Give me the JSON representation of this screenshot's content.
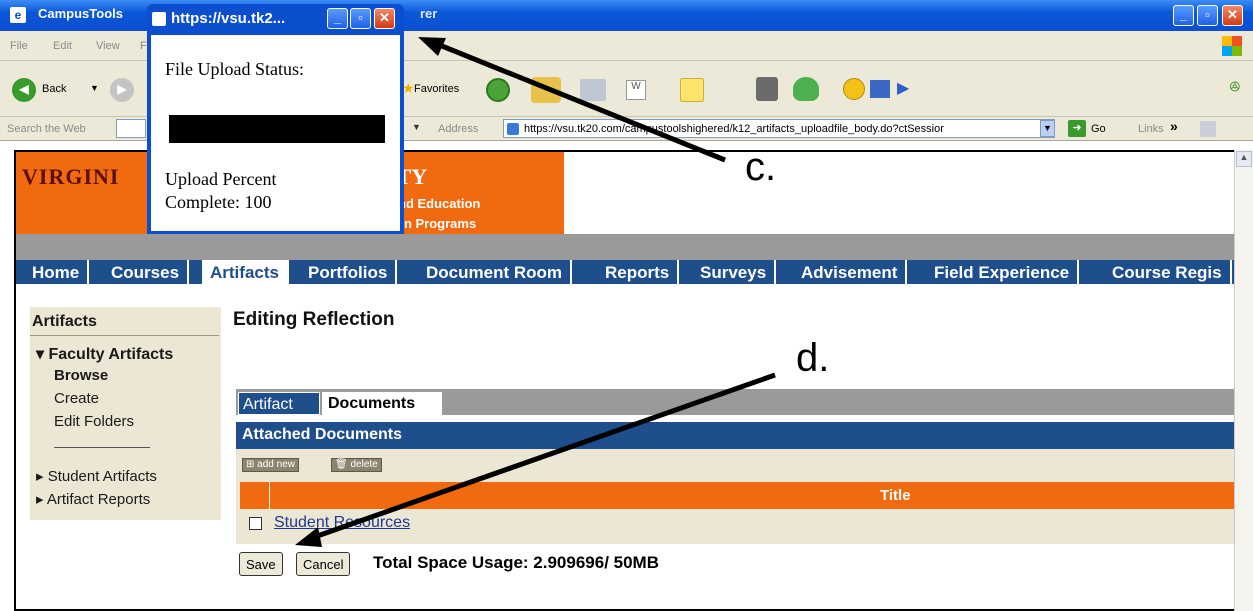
{
  "browser": {
    "title": "CampusTools",
    "title_suffix": "rer",
    "menu": [
      "File",
      "Edit",
      "View",
      "F"
    ],
    "toolbar": {
      "back": "Back",
      "favorites": "Favorites"
    },
    "search_label": "Search the Web",
    "address_label": "Address",
    "url": "https://vsu.tk20.com/campustoolshighered/k12_artifacts_uploadfile_body.do?ctSessior",
    "go": "Go",
    "links": "Links"
  },
  "popup": {
    "title": "https://vsu.tk2...",
    "status_label": "File Upload Status:",
    "percent_line1": "Upload Percent",
    "percent_line2": "Complete: 100",
    "progress": 100
  },
  "banner": {
    "name_left": "VIRGINI",
    "name_right": "ITY",
    "sub1": "nd Education",
    "sub2": "on Programs"
  },
  "nav": [
    "Home",
    "Courses",
    "Artifacts",
    "Portfolios",
    "Document Room",
    "Reports",
    "Surveys",
    "Advisement",
    "Field Experience",
    "Course Regis"
  ],
  "nav_active": "Artifacts",
  "sidebar": {
    "heading": "Artifacts",
    "items": [
      {
        "label": "▾ Faculty Artifacts"
      },
      {
        "label": "Browse"
      },
      {
        "label": "Create"
      },
      {
        "label": "Edit Folders"
      },
      {
        "label": "▸ Student Artifacts"
      },
      {
        "label": "▸ Artifact Reports"
      }
    ]
  },
  "main": {
    "title": "Editing Reflection",
    "tabs": [
      "Artifact",
      "Documents"
    ],
    "section": "Attached Documents",
    "add_new": "add new",
    "delete": "delete",
    "column_title": "Title",
    "rows": [
      {
        "title": "Student Resources"
      }
    ],
    "save": "Save",
    "cancel": "Cancel",
    "usage": "Total Space Usage:  2.909696/ 50MB"
  },
  "annotations": {
    "c": "c.",
    "d": "d."
  },
  "colors": {
    "xp_blue": "#0b4fcf",
    "brand_orange": "#f26a10",
    "nav_blue": "#1f4e8c",
    "panel_beige": "#ece6d4"
  }
}
